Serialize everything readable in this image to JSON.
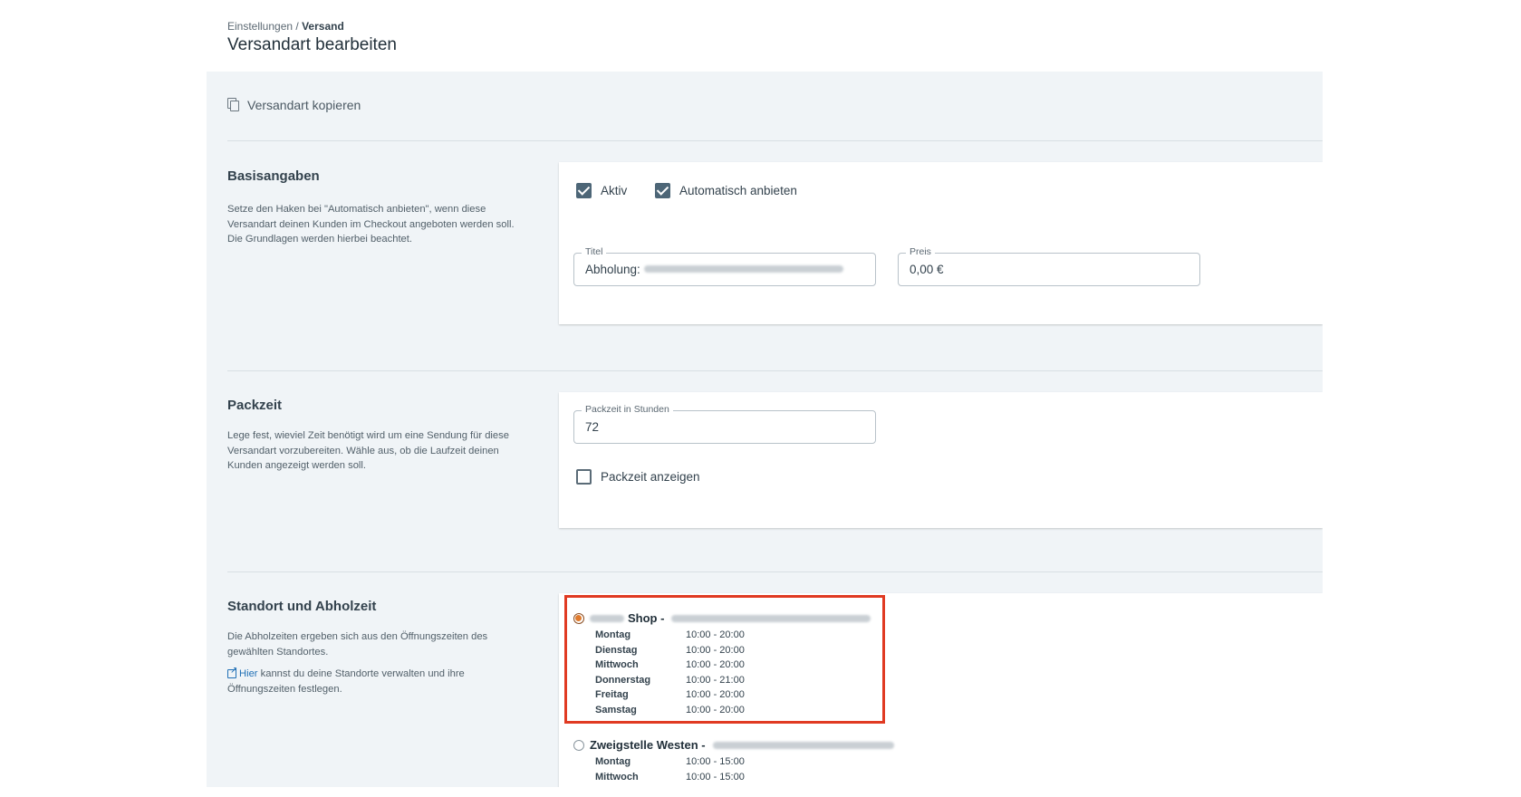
{
  "breadcrumb": {
    "parent": "Einstellungen",
    "separator": "/",
    "current": "Versand"
  },
  "page_title": "Versandart bearbeiten",
  "copy_action": {
    "label": "Versandart kopieren",
    "icon": "copy-icon"
  },
  "basis": {
    "title": "Basisangaben",
    "description": "Setze den Haken bei \"Automatisch anbieten\", wenn diese Versandart deinen Kunden im Checkout angeboten werden soll. Die Grundlagen werden hierbei beachtet.",
    "aktiv_label": "Aktiv",
    "aktiv_checked": true,
    "auto_label": "Automatisch anbieten",
    "auto_checked": true,
    "title_field": {
      "label": "Titel",
      "value": "Abholung:"
    },
    "price_field": {
      "label": "Preis",
      "value": "0,00 €"
    }
  },
  "packzeit": {
    "title": "Packzeit",
    "description": "Lege fest, wieviel Zeit benötigt wird um eine Sendung für diese Versandart vorzubereiten. Wähle aus, ob die Laufzeit deinen Kunden angezeigt werden soll.",
    "field": {
      "label": "Packzeit in Stunden",
      "value": "72"
    },
    "show_label": "Packzeit anzeigen",
    "show_checked": false
  },
  "standort": {
    "title": "Standort und Abholzeit",
    "description": "Die Abholzeiten ergeben sich aus den Öffnungszeiten des gewählten Standortes.",
    "link_text": "Hier",
    "link_rest": " kannst du deine Standorte verwalten und ihre Öffnungszeiten festlegen.",
    "locations": [
      {
        "name": "Shop -",
        "selected": true,
        "hours": [
          {
            "day": "Montag",
            "time": "10:00 - 20:00"
          },
          {
            "day": "Dienstag",
            "time": "10:00 - 20:00"
          },
          {
            "day": "Mittwoch",
            "time": "10:00 - 20:00"
          },
          {
            "day": "Donnerstag",
            "time": "10:00 - 21:00"
          },
          {
            "day": "Freitag",
            "time": "10:00 - 20:00"
          },
          {
            "day": "Samstag",
            "time": "10:00 - 20:00"
          }
        ]
      },
      {
        "name": "Zweigstelle Westen -",
        "selected": false,
        "hours": [
          {
            "day": "Montag",
            "time": "10:00 - 15:00"
          },
          {
            "day": "Mittwoch",
            "time": "10:00 - 15:00"
          }
        ]
      }
    ]
  },
  "colors": {
    "accent": "#4d6677",
    "highlight": "#e03a22",
    "link": "#1f6fb5",
    "panel": "#f0f4f7"
  }
}
